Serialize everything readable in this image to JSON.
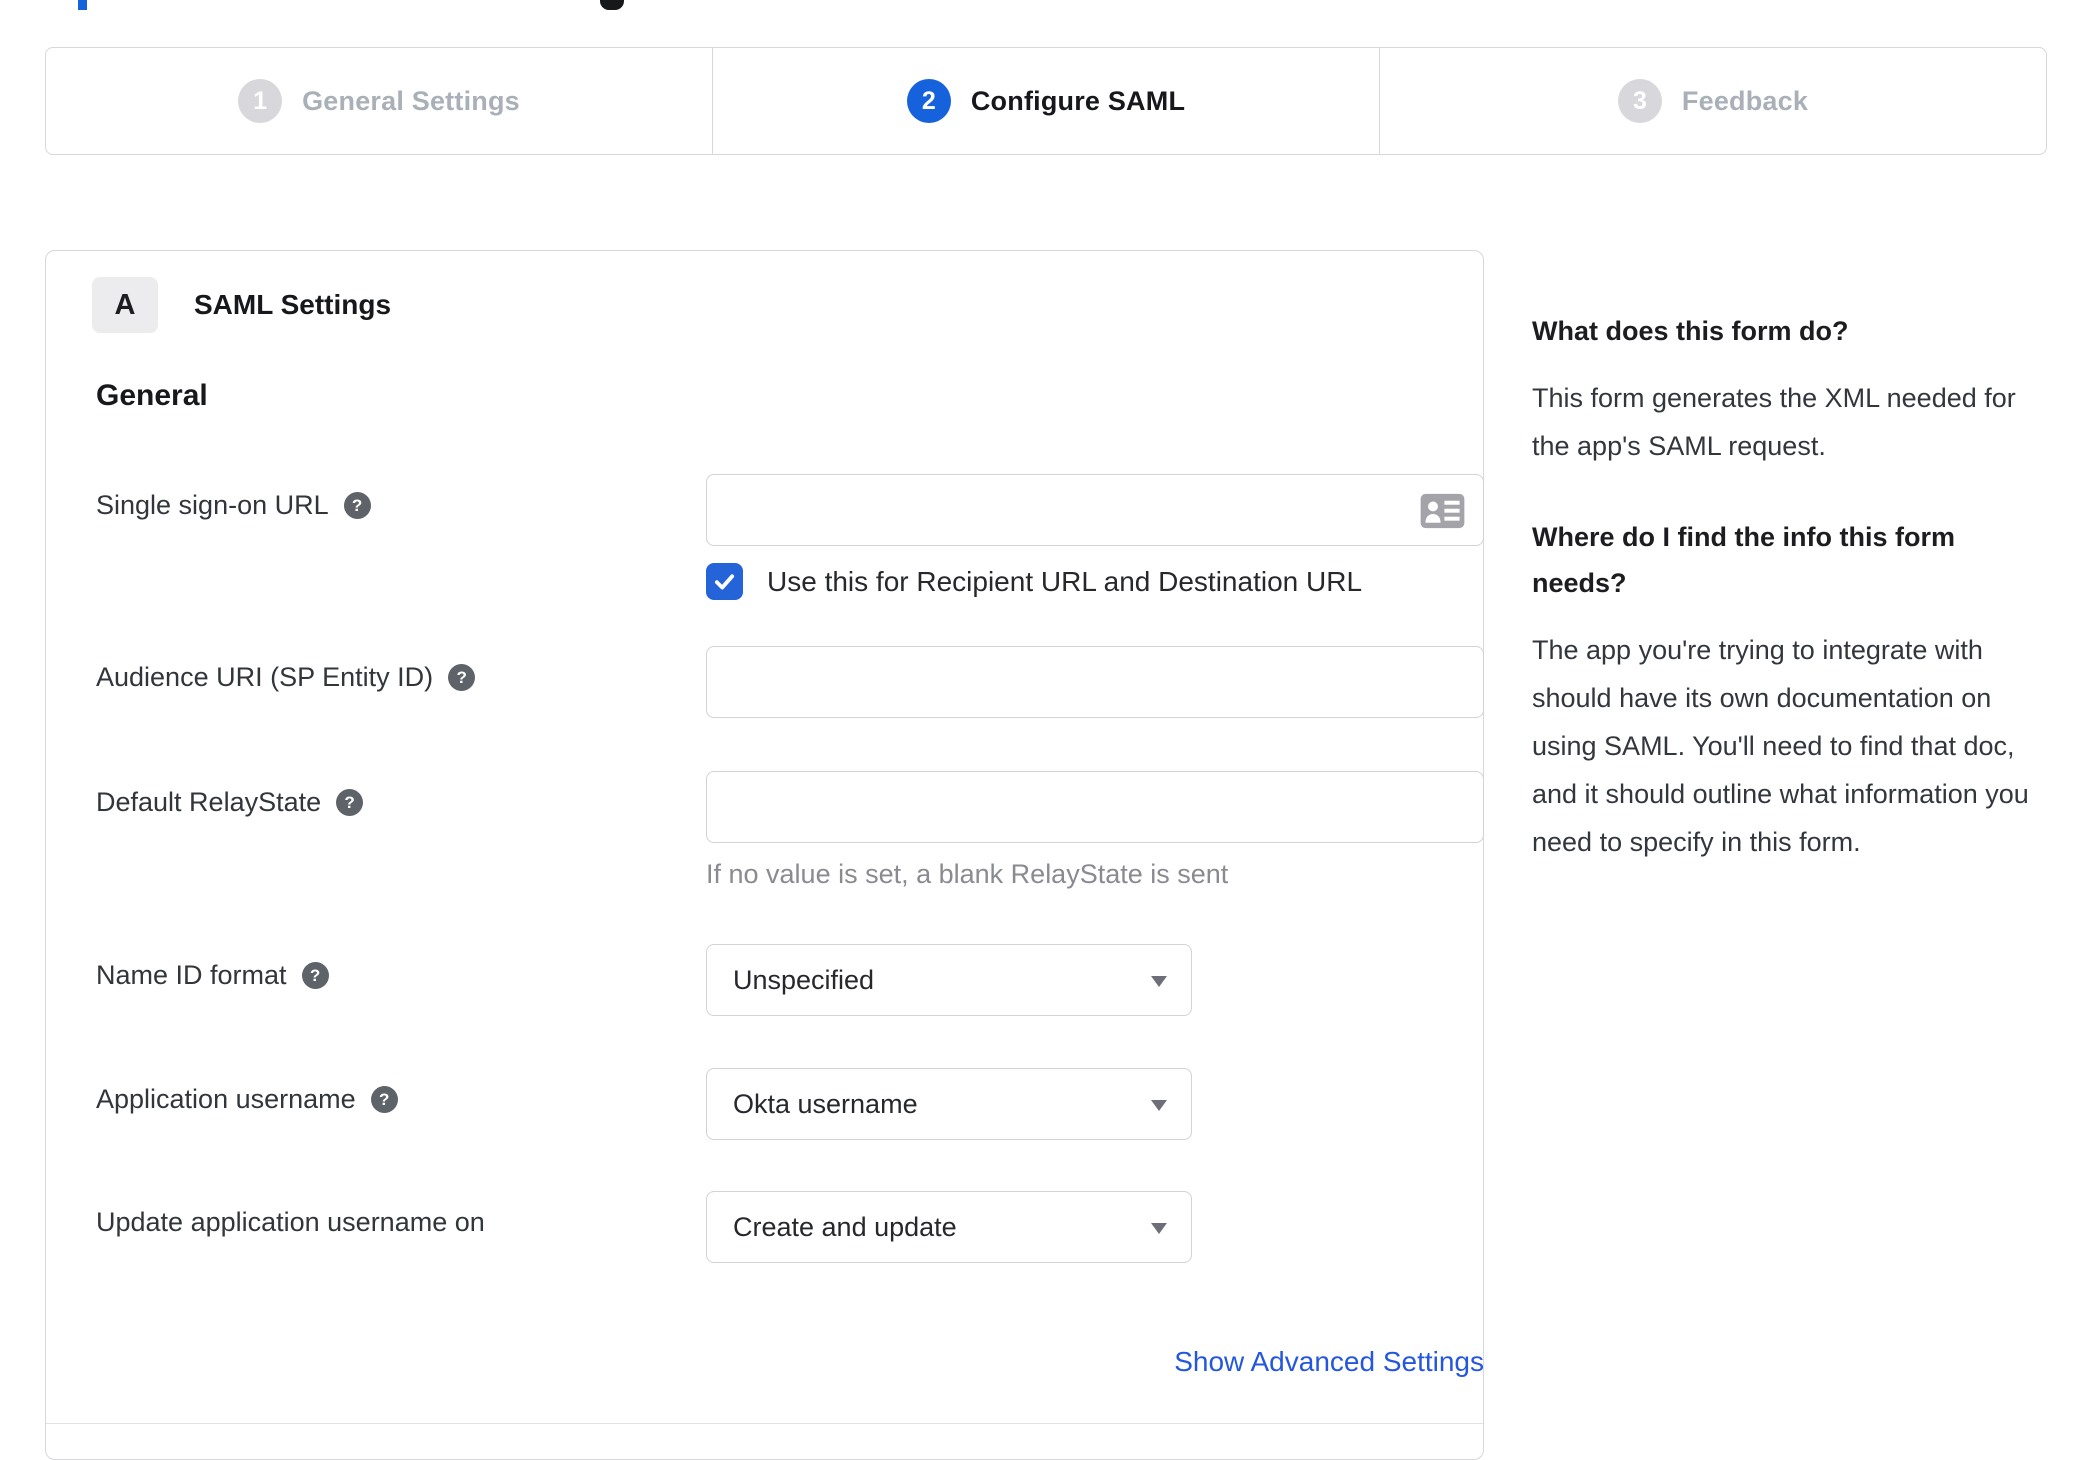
{
  "colors": {
    "accent_blue": "#1662dd",
    "checkbox_blue": "#2563d9",
    "link_blue": "#2457dd",
    "border_gray": "#d7d7dc",
    "inactive_gray": "#aab0b8",
    "muted_text": "#8a8a91"
  },
  "icons": {
    "help": "?"
  },
  "stepper": {
    "steps": [
      {
        "number": "1",
        "label": "General Settings",
        "active": false
      },
      {
        "number": "2",
        "label": "Configure SAML",
        "active": true
      },
      {
        "number": "3",
        "label": "Feedback",
        "active": false
      }
    ]
  },
  "panel": {
    "badge": "A",
    "title": "SAML Settings",
    "section": "General",
    "sso": {
      "label": "Single sign-on URL",
      "value": "",
      "checkbox_label": "Use this for Recipient URL and Destination URL",
      "checkbox_checked": true
    },
    "audience": {
      "label": "Audience URI (SP Entity ID)",
      "value": ""
    },
    "relay": {
      "label": "Default RelayState",
      "value": "",
      "hint": "If no value is set, a blank RelayState is sent"
    },
    "name_id": {
      "label": "Name ID format",
      "value": "Unspecified"
    },
    "app_username": {
      "label": "Application username",
      "value": "Okta username"
    },
    "update_username": {
      "label": "Update application username on",
      "value": "Create and update"
    },
    "advanced_link": "Show Advanced Settings"
  },
  "sidebar": {
    "q1": {
      "heading": "What does this form do?",
      "body": "This form generates the XML needed for the app's SAML request."
    },
    "q2": {
      "heading": "Where do I find the info this form needs?",
      "body": "The app you're trying to integrate with should have its own documentation on using SAML. You'll need to find that doc, and it should outline what information you need to specify in this form."
    }
  }
}
